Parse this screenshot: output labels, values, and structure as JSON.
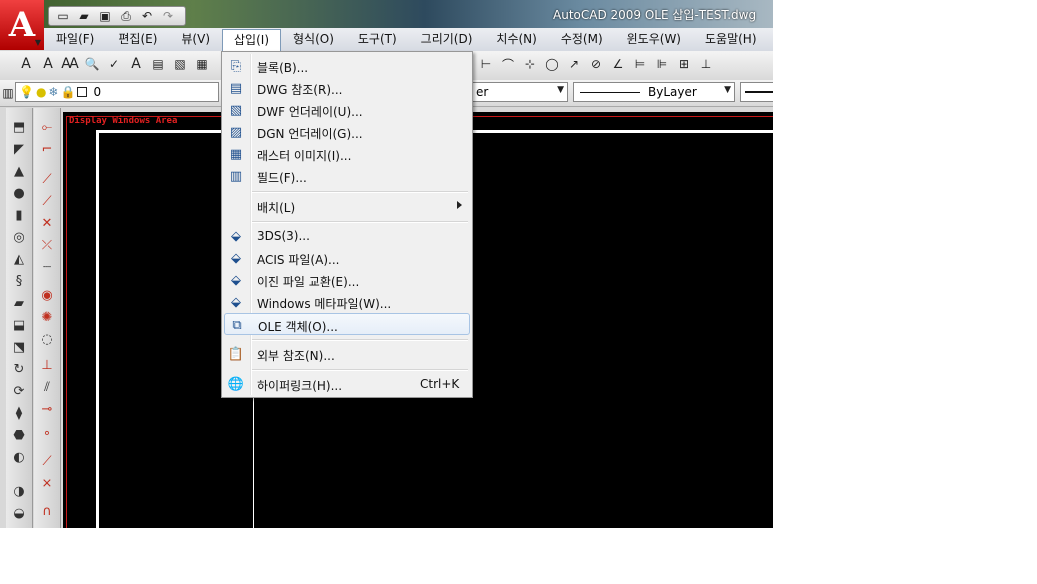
{
  "window": {
    "title": "AutoCAD 2009 OLE 삽입-TEST.dwg"
  },
  "menubar": [
    {
      "label": "파일(F)"
    },
    {
      "label": "편집(E)"
    },
    {
      "label": "뷰(V)"
    },
    {
      "label": "삽입(I)"
    },
    {
      "label": "형식(O)"
    },
    {
      "label": "도구(T)"
    },
    {
      "label": "그리기(D)"
    },
    {
      "label": "치수(N)"
    },
    {
      "label": "수정(M)"
    },
    {
      "label": "윈도우(W)"
    },
    {
      "label": "도움말(H)"
    }
  ],
  "toolbar2": {
    "layer_value": "0",
    "color_combo": "er",
    "linetype_combo": "ByLayer"
  },
  "drawing": {
    "label": "Display Windows Area"
  },
  "insert_menu": {
    "items": [
      {
        "label": "블록(B)...",
        "icon": "block-icon"
      },
      {
        "label": "DWG 참조(R)...",
        "icon": "dwg-reference-icon"
      },
      {
        "label": "DWF 언더레이(U)...",
        "icon": "dwf-underlay-icon"
      },
      {
        "label": "DGN 언더레이(G)...",
        "icon": "dgn-underlay-icon"
      },
      {
        "label": "래스터 이미지(I)...",
        "icon": "raster-image-icon"
      },
      {
        "label": "필드(F)...",
        "icon": "field-icon"
      },
      {
        "label": "배치(L)",
        "icon": "",
        "submenu": true
      },
      {
        "label": "3DS(3)...",
        "icon": "3ds-icon"
      },
      {
        "label": "ACIS 파일(A)...",
        "icon": "acis-file-icon"
      },
      {
        "label": "이진 파일 교환(E)...",
        "icon": "binary-exchange-icon"
      },
      {
        "label": "Windows 메타파일(W)...",
        "icon": "windows-metafile-icon"
      },
      {
        "label": "OLE 객체(O)...",
        "icon": "ole-object-icon",
        "highlighted": true
      },
      {
        "label": "외부 참조(N)...",
        "icon": "external-reference-icon"
      },
      {
        "label": "하이퍼링크(H)...",
        "icon": "hyperlink-icon",
        "shortcut": "Ctrl+K"
      }
    ]
  }
}
